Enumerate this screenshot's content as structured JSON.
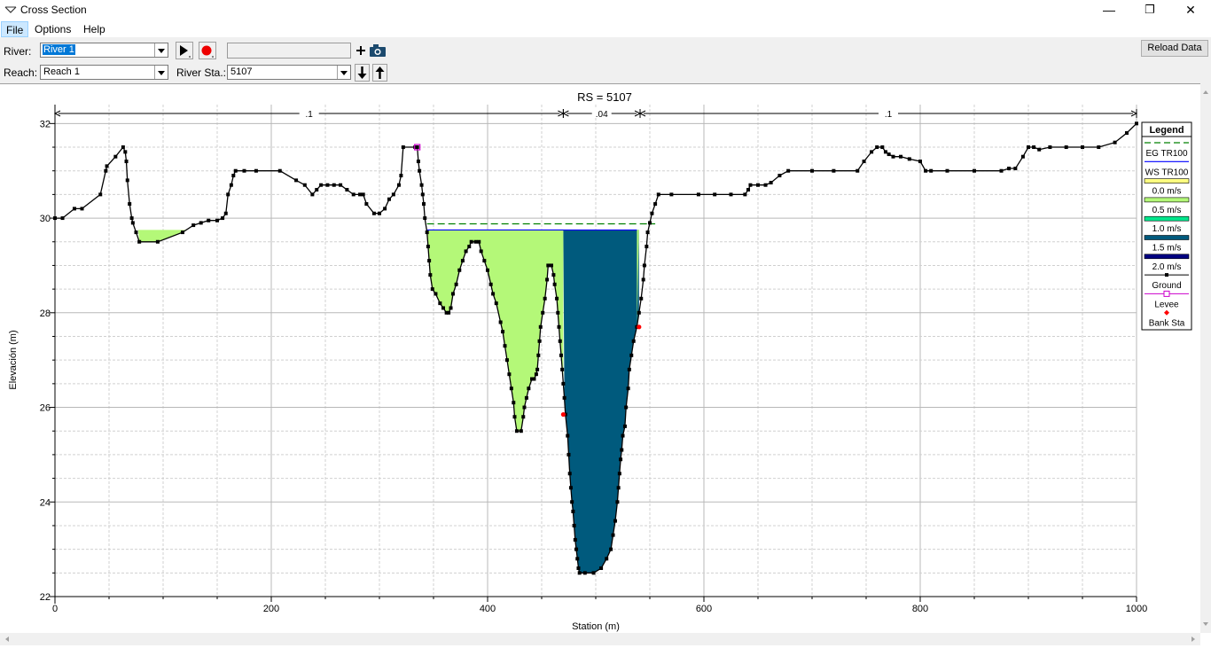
{
  "window": {
    "title": "Cross Section",
    "min_glyph": "—",
    "max_glyph": "❐",
    "close_glyph": "✕"
  },
  "menu": [
    {
      "label": "File"
    },
    {
      "label": "Options"
    },
    {
      "label": "Help"
    }
  ],
  "toolbar": {
    "river_label": "River:",
    "river_value": "River 1",
    "reach_label": "Reach:",
    "reach_value": "Reach 1",
    "station_label": "River Sta.:",
    "station_value": "5107",
    "reload_label": "Reload Data",
    "play_icon": "play-icon",
    "record_icon": "record-icon",
    "camera_icon": "add-camera-icon",
    "down_icon": "arrow-down-icon",
    "up_icon": "arrow-up-icon"
  },
  "chart_data": {
    "type": "area",
    "title": "RS = 5107",
    "xlabel": "Station (m)",
    "ylabel": "Elevación (m)",
    "xlim": [
      0,
      1000
    ],
    "ylim": [
      22,
      32.4
    ],
    "xticks": [
      0,
      200,
      400,
      600,
      800,
      1000
    ],
    "yticks": [
      22,
      24,
      26,
      28,
      30,
      32
    ],
    "grid": true,
    "legend_position": "right",
    "legend": {
      "title": "Legend",
      "entries": [
        {
          "label": "EG TR100",
          "kind": "dashed",
          "color": "#008000"
        },
        {
          "label": "WS TR100",
          "kind": "line",
          "color": "#0000ff"
        },
        {
          "label": "0.0 m/s",
          "kind": "swatch",
          "color": "#ffff80"
        },
        {
          "label": "0.5 m/s",
          "kind": "swatch",
          "color": "#b4f878"
        },
        {
          "label": "1.0 m/s",
          "kind": "swatch",
          "color": "#00e68c"
        },
        {
          "label": "1.5 m/s",
          "kind": "swatch",
          "color": "#005a7d"
        },
        {
          "label": "2.0 m/s",
          "kind": "swatch",
          "color": "#000080"
        },
        {
          "label": "Ground",
          "kind": "ground",
          "color": "#000000"
        },
        {
          "label": "Levee",
          "kind": "levee",
          "color": "#cc00cc"
        },
        {
          "label": "Bank Sta",
          "kind": "bank",
          "color": "#ff0000"
        }
      ]
    },
    "colors": {
      "left_fill": "#b4f878",
      "channel_fill": "#005a7d",
      "ground": "#000000",
      "eg": "#008000",
      "ws": "#0000ff",
      "bank": "#ff0000",
      "levee": "#cc00cc"
    },
    "manning": [
      {
        "label": ".1",
        "from": 0,
        "to": 470
      },
      {
        "label": ".04",
        "from": 470,
        "to": 541
      },
      {
        "label": ".1",
        "from": 541,
        "to": 1000
      }
    ],
    "ws_elevation": 29.75,
    "ws_range": [
      344,
      538
    ],
    "eg_elevation": 29.88,
    "eg_range": [
      344,
      555
    ],
    "bank_stations": [
      {
        "x": 470,
        "y": 25.85
      },
      {
        "x": 540,
        "y": 27.7
      }
    ],
    "levee": {
      "x": 335,
      "y": 31.5
    },
    "left_pond": {
      "ws": 29.75,
      "x_start": 77,
      "x_end": 122
    },
    "ground": [
      [
        0,
        30
      ],
      [
        7,
        30
      ],
      [
        18,
        30.2
      ],
      [
        25,
        30.2
      ],
      [
        42,
        30.5
      ],
      [
        47,
        31
      ],
      [
        48,
        31.1
      ],
      [
        56,
        31.3
      ],
      [
        63,
        31.5
      ],
      [
        65,
        31.4
      ],
      [
        66,
        31.2
      ],
      [
        67,
        30.8
      ],
      [
        69,
        30.3
      ],
      [
        71,
        30
      ],
      [
        72,
        29.9
      ],
      [
        75,
        29.7
      ],
      [
        78,
        29.5
      ],
      [
        95,
        29.5
      ],
      [
        118,
        29.7
      ],
      [
        128,
        29.85
      ],
      [
        135,
        29.9
      ],
      [
        142,
        29.95
      ],
      [
        150,
        29.95
      ],
      [
        155,
        30
      ],
      [
        158,
        30.1
      ],
      [
        160,
        30.5
      ],
      [
        163,
        30.7
      ],
      [
        165,
        30.9
      ],
      [
        167,
        31
      ],
      [
        175,
        31
      ],
      [
        186,
        31
      ],
      [
        208,
        31
      ],
      [
        223,
        30.8
      ],
      [
        231,
        30.7
      ],
      [
        238,
        30.5
      ],
      [
        242,
        30.6
      ],
      [
        246,
        30.7
      ],
      [
        252,
        30.7
      ],
      [
        258,
        30.7
      ],
      [
        264,
        30.7
      ],
      [
        270,
        30.6
      ],
      [
        276,
        30.5
      ],
      [
        282,
        30.5
      ],
      [
        285,
        30.5
      ],
      [
        288,
        30.3
      ],
      [
        295,
        30.1
      ],
      [
        300,
        30.1
      ],
      [
        305,
        30.2
      ],
      [
        309,
        30.4
      ],
      [
        313,
        30.5
      ],
      [
        318,
        30.7
      ],
      [
        320,
        30.9
      ],
      [
        322,
        31.5
      ],
      [
        333,
        31.5
      ],
      [
        335,
        31.5
      ],
      [
        336,
        31.2
      ],
      [
        337,
        31
      ],
      [
        339,
        30.7
      ],
      [
        340,
        30.5
      ],
      [
        341,
        30.3
      ],
      [
        342,
        30
      ],
      [
        344,
        29.7
      ],
      [
        345,
        29.4
      ],
      [
        346,
        29.1
      ],
      [
        347,
        28.8
      ],
      [
        349,
        28.5
      ],
      [
        352,
        28.4
      ],
      [
        356,
        28.2
      ],
      [
        359,
        28.1
      ],
      [
        362,
        28
      ],
      [
        364,
        28
      ],
      [
        366,
        28.1
      ],
      [
        368,
        28.4
      ],
      [
        371,
        28.6
      ],
      [
        374,
        28.9
      ],
      [
        377,
        29.1
      ],
      [
        380,
        29.3
      ],
      [
        383,
        29.4
      ],
      [
        385,
        29.5
      ],
      [
        389,
        29.5
      ],
      [
        392,
        29.5
      ],
      [
        394,
        29.3
      ],
      [
        397,
        29.1
      ],
      [
        400,
        28.9
      ],
      [
        403,
        28.6
      ],
      [
        405,
        28.4
      ],
      [
        408,
        28.2
      ],
      [
        412,
        27.8
      ],
      [
        414,
        27.6
      ],
      [
        416,
        27.3
      ],
      [
        418,
        27
      ],
      [
        420,
        26.7
      ],
      [
        422,
        26.4
      ],
      [
        424,
        26.1
      ],
      [
        425,
        25.8
      ],
      [
        427,
        25.5
      ],
      [
        431,
        25.5
      ],
      [
        433,
        25.8
      ],
      [
        434,
        26
      ],
      [
        436,
        26.2
      ],
      [
        438,
        26.4
      ],
      [
        441,
        26.6
      ],
      [
        443,
        26.6
      ],
      [
        445,
        26.7
      ],
      [
        446,
        26.8
      ],
      [
        447,
        27.1
      ],
      [
        448,
        27.4
      ],
      [
        449,
        27.7
      ],
      [
        451,
        28
      ],
      [
        453,
        28.3
      ],
      [
        455,
        28.7
      ],
      [
        456,
        29
      ],
      [
        459,
        29
      ],
      [
        461,
        28.8
      ],
      [
        462,
        28.6
      ],
      [
        464,
        28.3
      ],
      [
        465,
        28
      ],
      [
        466,
        27.7
      ],
      [
        467,
        27.4
      ],
      [
        468,
        27.1
      ],
      [
        469,
        26.8
      ],
      [
        470,
        26.5
      ],
      [
        471,
        26.2
      ],
      [
        472,
        25.85
      ],
      [
        474,
        25.4
      ],
      [
        475,
        25
      ],
      [
        476,
        24.6
      ],
      [
        477,
        24.3
      ],
      [
        478,
        24
      ],
      [
        479,
        23.8
      ],
      [
        480,
        23.5
      ],
      [
        481,
        23.2
      ],
      [
        482,
        23
      ],
      [
        483,
        22.8
      ],
      [
        484,
        22.6
      ],
      [
        485,
        22.5
      ],
      [
        490,
        22.5
      ],
      [
        498,
        22.5
      ],
      [
        505,
        22.6
      ],
      [
        510,
        22.8
      ],
      [
        514,
        23
      ],
      [
        516,
        23.3
      ],
      [
        518,
        23.6
      ],
      [
        520,
        24
      ],
      [
        521,
        24.3
      ],
      [
        522,
        24.6
      ],
      [
        523,
        24.9
      ],
      [
        524,
        25.1
      ],
      [
        525,
        25.4
      ],
      [
        527,
        25.6
      ],
      [
        528,
        26
      ],
      [
        530,
        26.4
      ],
      [
        531,
        26.8
      ],
      [
        533,
        27.1
      ],
      [
        535,
        27.4
      ],
      [
        538,
        27.7
      ],
      [
        540,
        28
      ],
      [
        542,
        28.3
      ],
      [
        544,
        28.7
      ],
      [
        545,
        29
      ],
      [
        547,
        29.4
      ],
      [
        548,
        29.7
      ],
      [
        550,
        29.9
      ],
      [
        552,
        30.1
      ],
      [
        555,
        30.3
      ],
      [
        558,
        30.5
      ],
      [
        570,
        30.5
      ],
      [
        595,
        30.5
      ],
      [
        610,
        30.5
      ],
      [
        625,
        30.5
      ],
      [
        638,
        30.5
      ],
      [
        641,
        30.6
      ],
      [
        643,
        30.7
      ],
      [
        650,
        30.7
      ],
      [
        657,
        30.7
      ],
      [
        662,
        30.75
      ],
      [
        670,
        30.9
      ],
      [
        678,
        31
      ],
      [
        700,
        31
      ],
      [
        720,
        31
      ],
      [
        742,
        31
      ],
      [
        748,
        31.2
      ],
      [
        755,
        31.4
      ],
      [
        760,
        31.5
      ],
      [
        765,
        31.5
      ],
      [
        768,
        31.4
      ],
      [
        771,
        31.35
      ],
      [
        775,
        31.3
      ],
      [
        782,
        31.3
      ],
      [
        790,
        31.25
      ],
      [
        800,
        31.2
      ],
      [
        805,
        31
      ],
      [
        810,
        31
      ],
      [
        825,
        31
      ],
      [
        850,
        31
      ],
      [
        875,
        31
      ],
      [
        882,
        31.05
      ],
      [
        888,
        31.05
      ],
      [
        895,
        31.3
      ],
      [
        900,
        31.5
      ],
      [
        905,
        31.5
      ],
      [
        910,
        31.45
      ],
      [
        920,
        31.5
      ],
      [
        935,
        31.5
      ],
      [
        950,
        31.5
      ],
      [
        965,
        31.5
      ],
      [
        980,
        31.6
      ],
      [
        991,
        31.8
      ],
      [
        1000,
        32
      ]
    ]
  }
}
